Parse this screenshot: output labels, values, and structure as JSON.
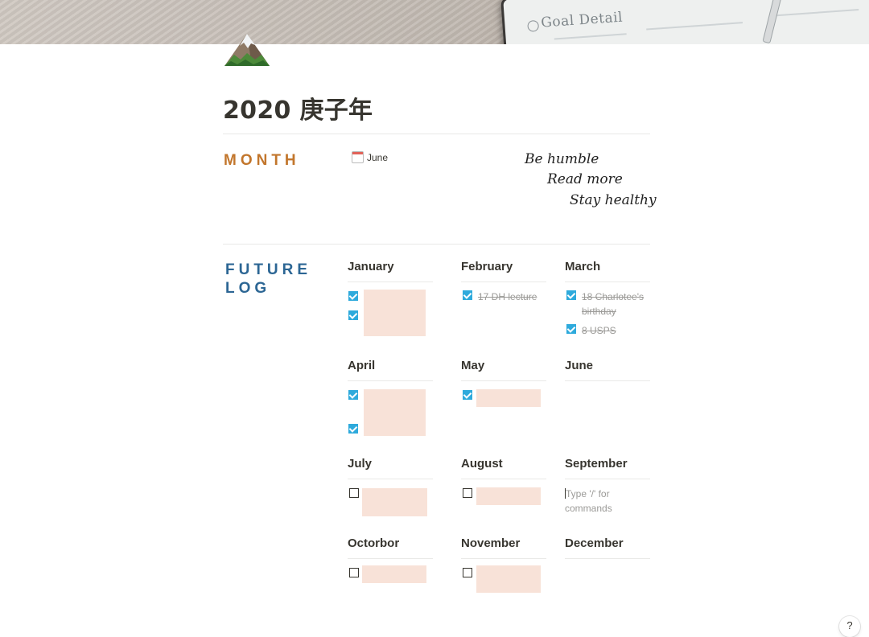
{
  "cover": {
    "notebook_title": "Goal Detail"
  },
  "page": {
    "title": "2020 庚子年",
    "icon": "mountain-icon"
  },
  "month_section": {
    "label": "MONTH",
    "value": "June",
    "value_icon": "calendar-icon",
    "motto": [
      "Be humble",
      "Read more",
      "Stay healthy"
    ]
  },
  "future_log": {
    "label_line1": "FUTURE",
    "label_line2": "LOG",
    "months": {
      "jan": {
        "name": "January"
      },
      "feb": {
        "name": "February",
        "todos": [
          "17 DH lecture"
        ]
      },
      "mar": {
        "name": "March",
        "todos": [
          "18 Charlotee's birthday",
          "8 USPS"
        ]
      },
      "apr": {
        "name": "April"
      },
      "may": {
        "name": "May"
      },
      "jun": {
        "name": "June"
      },
      "jul": {
        "name": "July"
      },
      "aug": {
        "name": "August"
      },
      "sep": {
        "name": "September",
        "placeholder": "Type '/' for commands"
      },
      "oct": {
        "name": "Octorbor"
      },
      "nov": {
        "name": "November"
      },
      "dec": {
        "name": "December"
      }
    }
  },
  "help": {
    "label": "?"
  },
  "colors": {
    "month_label": "#c2762c",
    "future_label": "#2c6694",
    "checkbox": "#2eaadc",
    "redaction": "#f8e2d8"
  }
}
